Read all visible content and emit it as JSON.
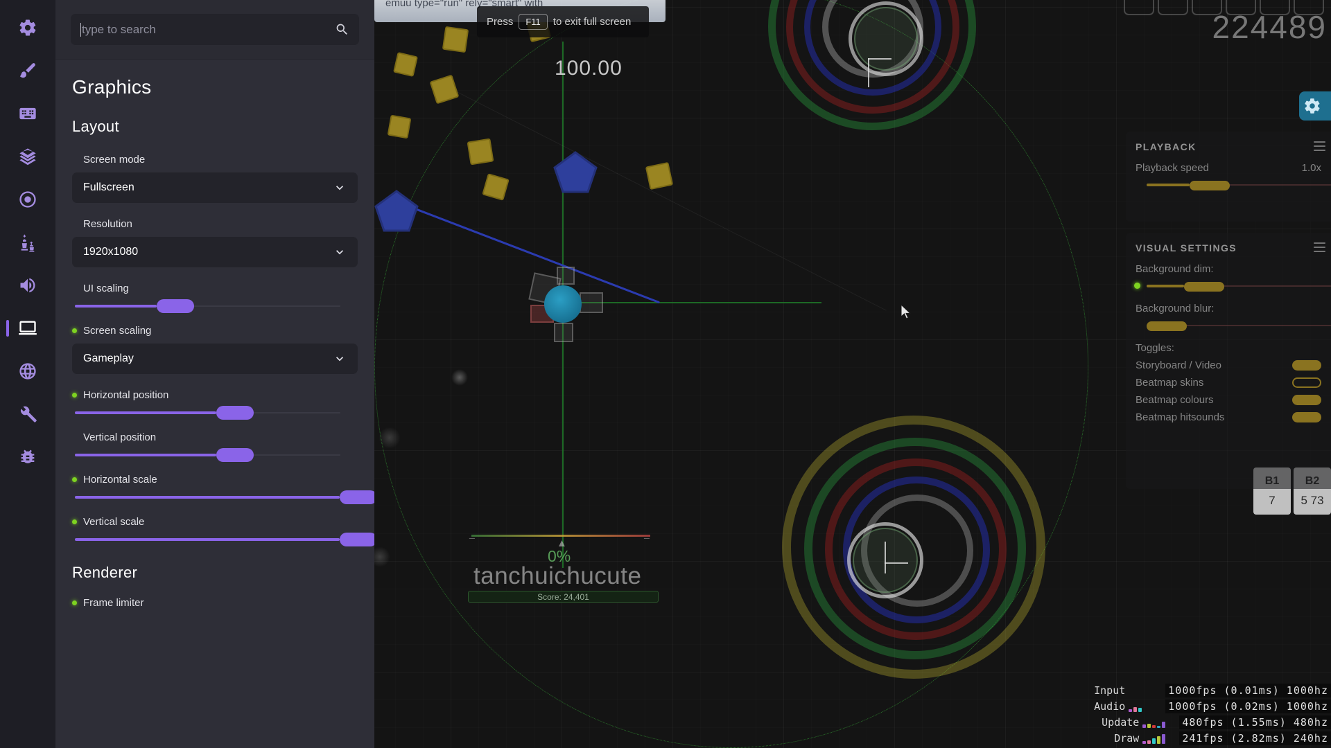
{
  "settings": {
    "search": {
      "placeholder": "type to search",
      "icon": "search-icon"
    },
    "sidebar": [
      {
        "name": "general",
        "icon": "gear-icon",
        "active": false
      },
      {
        "name": "skin",
        "icon": "paintbrush-icon",
        "active": false
      },
      {
        "name": "input",
        "icon": "keyboard-icon",
        "active": false
      },
      {
        "name": "userinterface",
        "icon": "layers-icon",
        "active": false
      },
      {
        "name": "gameplay",
        "icon": "circle-dot-icon",
        "active": false
      },
      {
        "name": "rulesets",
        "icon": "chess-icon",
        "active": false
      },
      {
        "name": "audio",
        "icon": "speaker-icon",
        "active": false
      },
      {
        "name": "graphics",
        "icon": "laptop-icon",
        "active": true
      },
      {
        "name": "online",
        "icon": "globe-icon",
        "active": false
      },
      {
        "name": "maintenance",
        "icon": "wrench-icon",
        "active": false
      },
      {
        "name": "debug",
        "icon": "bug-icon",
        "active": false
      }
    ],
    "title": "Graphics",
    "sections": [
      {
        "heading": "Layout",
        "items": [
          {
            "kind": "dropdown",
            "label": "Screen mode",
            "value": "Fullscreen",
            "bullet": false
          },
          {
            "kind": "dropdown",
            "label": "Resolution",
            "value": "1920x1080",
            "bullet": false
          },
          {
            "kind": "slider",
            "label": "UI scaling",
            "percent": 35,
            "bullet": false
          },
          {
            "kind": "dropdown",
            "label": "Screen scaling",
            "value": "Gameplay",
            "bullet": true
          },
          {
            "kind": "slider",
            "label": "Horizontal position",
            "percent": 56,
            "bullet": true
          },
          {
            "kind": "slider",
            "label": "Vertical position",
            "percent": 56,
            "bullet": false
          },
          {
            "kind": "slider",
            "label": "Horizontal scale",
            "percent": 100,
            "bullet": true
          },
          {
            "kind": "slider",
            "label": "Vertical scale",
            "percent": 100,
            "bullet": true
          }
        ]
      },
      {
        "heading": "Renderer",
        "items": [
          {
            "kind": "label",
            "label": "Frame limiter",
            "bullet": true
          }
        ]
      }
    ]
  },
  "game": {
    "accuracy": "100.00",
    "score": "224489",
    "username": "tanchuichucute",
    "score_bar_label": "Score: 24,401",
    "progress_percent": "0%",
    "exit_fullscreen": {
      "prefix": "Press",
      "key": "F11",
      "suffix": "to exit full screen"
    },
    "url_bar_text": "emuu type=\"run\" rely=\"smart\" with",
    "key_counters": [
      {
        "label": "B1",
        "value": "7"
      },
      {
        "label": "B2",
        "value": "5 73"
      }
    ],
    "gear_icon": "settings-cog-icon"
  },
  "playback_panel": {
    "heading": "PLAYBACK",
    "speed_label": "Playback speed",
    "speed_value": "1.0x",
    "speed_percent": 42
  },
  "visual_settings_panel": {
    "heading": "VISUAL SETTINGS",
    "background_dim_label": "Background dim:",
    "background_dim_percent": 42,
    "background_blur_label": "Background blur:",
    "background_blur_percent": 0,
    "toggles_label": "Toggles:",
    "toggles": [
      {
        "label": "Storyboard / Video",
        "on": true
      },
      {
        "label": "Beatmap skins",
        "on": false
      },
      {
        "label": "Beatmap colours",
        "on": true
      },
      {
        "label": "Beatmap hitsounds",
        "on": true
      }
    ]
  },
  "fps_counter": {
    "rows": [
      {
        "label": "Input",
        "value": "1000fps (0.01ms) 1000hz"
      },
      {
        "label": "Audio",
        "value": "1000fps (0.02ms) 1000hz"
      },
      {
        "label": "Update",
        "value": "480fps (1.55ms) 480hz"
      },
      {
        "label": "Draw",
        "value": "241fps (2.82ms) 240hz"
      }
    ]
  },
  "colors": {
    "accent_purple": "#8a64e8",
    "panel_bg": "#2e2e37",
    "sidebar_bg": "#1e1e25",
    "dropdown_bg": "#23232a",
    "bullet_green": "#7ed321",
    "gold": "#8a7320"
  }
}
